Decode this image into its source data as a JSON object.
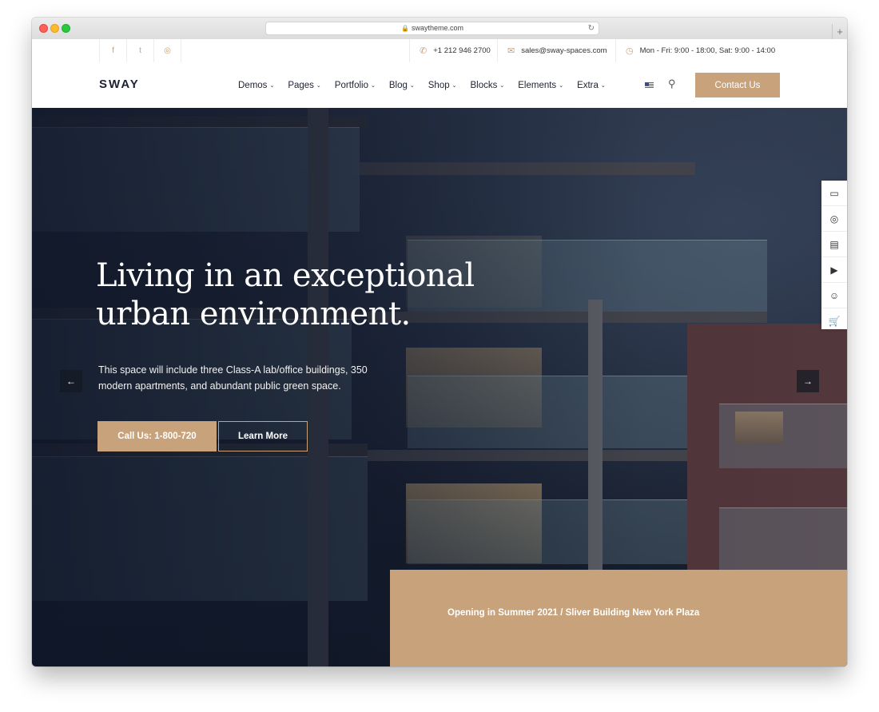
{
  "browser": {
    "url": "swaytheme.com"
  },
  "topbar": {
    "social": [
      {
        "icon": "facebook-icon",
        "glyph": "f"
      },
      {
        "icon": "twitter-icon",
        "glyph": "t"
      },
      {
        "icon": "instagram-icon",
        "glyph": "◎"
      }
    ],
    "phone": "+1 212 946 2700",
    "email": "sales@sway-spaces.com",
    "hours": "Mon - Fri: 9:00 - 18:00, Sat: 9:00 - 14:00"
  },
  "nav": {
    "logo": "SWAY",
    "items": [
      "Demos",
      "Pages",
      "Portfolio",
      "Blog",
      "Shop",
      "Blocks",
      "Elements",
      "Extra"
    ],
    "contact_label": "Contact Us"
  },
  "hero": {
    "headline_line1": "Living in an exceptional",
    "headline_line2": "urban environment.",
    "subtext_line1": "This space will include three Class-A lab/office buildings, 350",
    "subtext_line2": "modern apartments, and abundant public green space.",
    "call_label": "Call Us: 1-800-720",
    "learn_label": "Learn More",
    "banner_text": "Opening in Summer 2021 / Sliver Building New York Plaza"
  },
  "colors": {
    "accent": "#c8a27a",
    "dark_text": "#1d2233",
    "hero_dark": "#141b29"
  },
  "sidebar_icons": [
    "chat-icon",
    "support-icon",
    "document-icon",
    "video-icon",
    "users-icon",
    "cart-icon"
  ]
}
